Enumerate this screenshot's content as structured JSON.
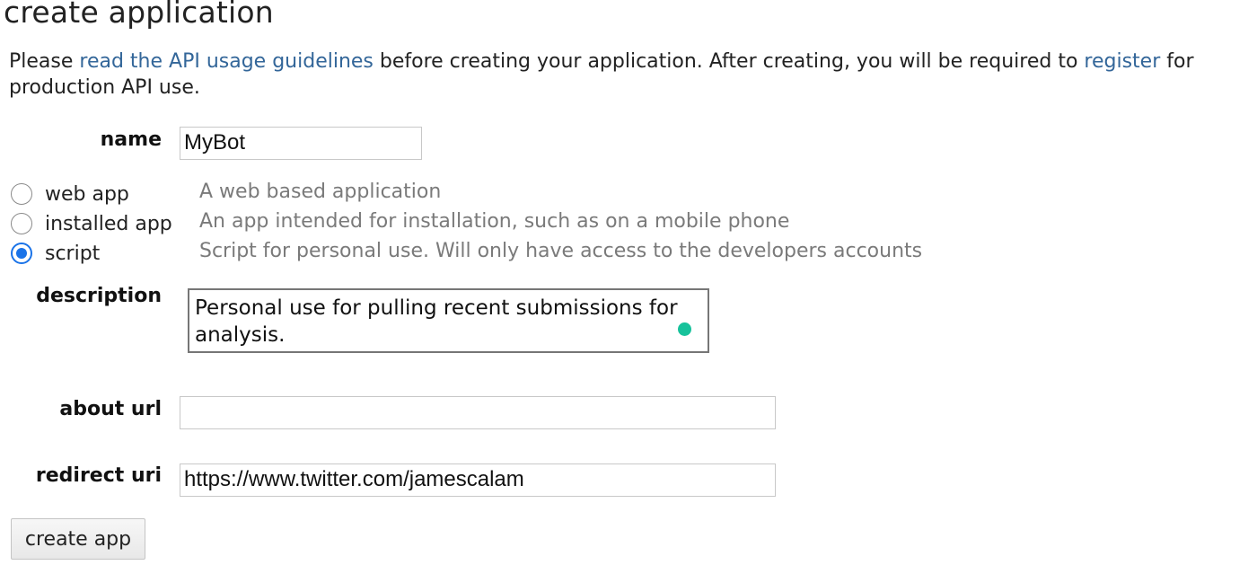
{
  "page_title": "create application",
  "intro": {
    "before_link1": "Please ",
    "link1": "read the API usage guidelines",
    "middle": " before creating your application. After creating, you will be required to ",
    "link2": "register",
    "after_link2": " for production API use."
  },
  "form": {
    "name_label": "name",
    "name_value": "MyBot",
    "app_types": [
      {
        "label": "web app",
        "description": "A web based application",
        "checked": false
      },
      {
        "label": "installed app",
        "description": "An app intended for installation, such as on a mobile phone",
        "checked": false
      },
      {
        "label": "script",
        "description": "Script for personal use. Will only have access to the developers accounts",
        "checked": true
      }
    ],
    "description_label": "description",
    "description_value": "Personal use for pulling recent submissions for analysis.",
    "about_url_label": "about url",
    "about_url_value": "",
    "redirect_uri_label": "redirect uri",
    "redirect_uri_value": "https://www.twitter.com/jamescalam",
    "submit_label": "create app"
  },
  "colors": {
    "link": "#336699",
    "radio_checked": "#1a73e8",
    "grammar_dot": "#17c29b"
  }
}
